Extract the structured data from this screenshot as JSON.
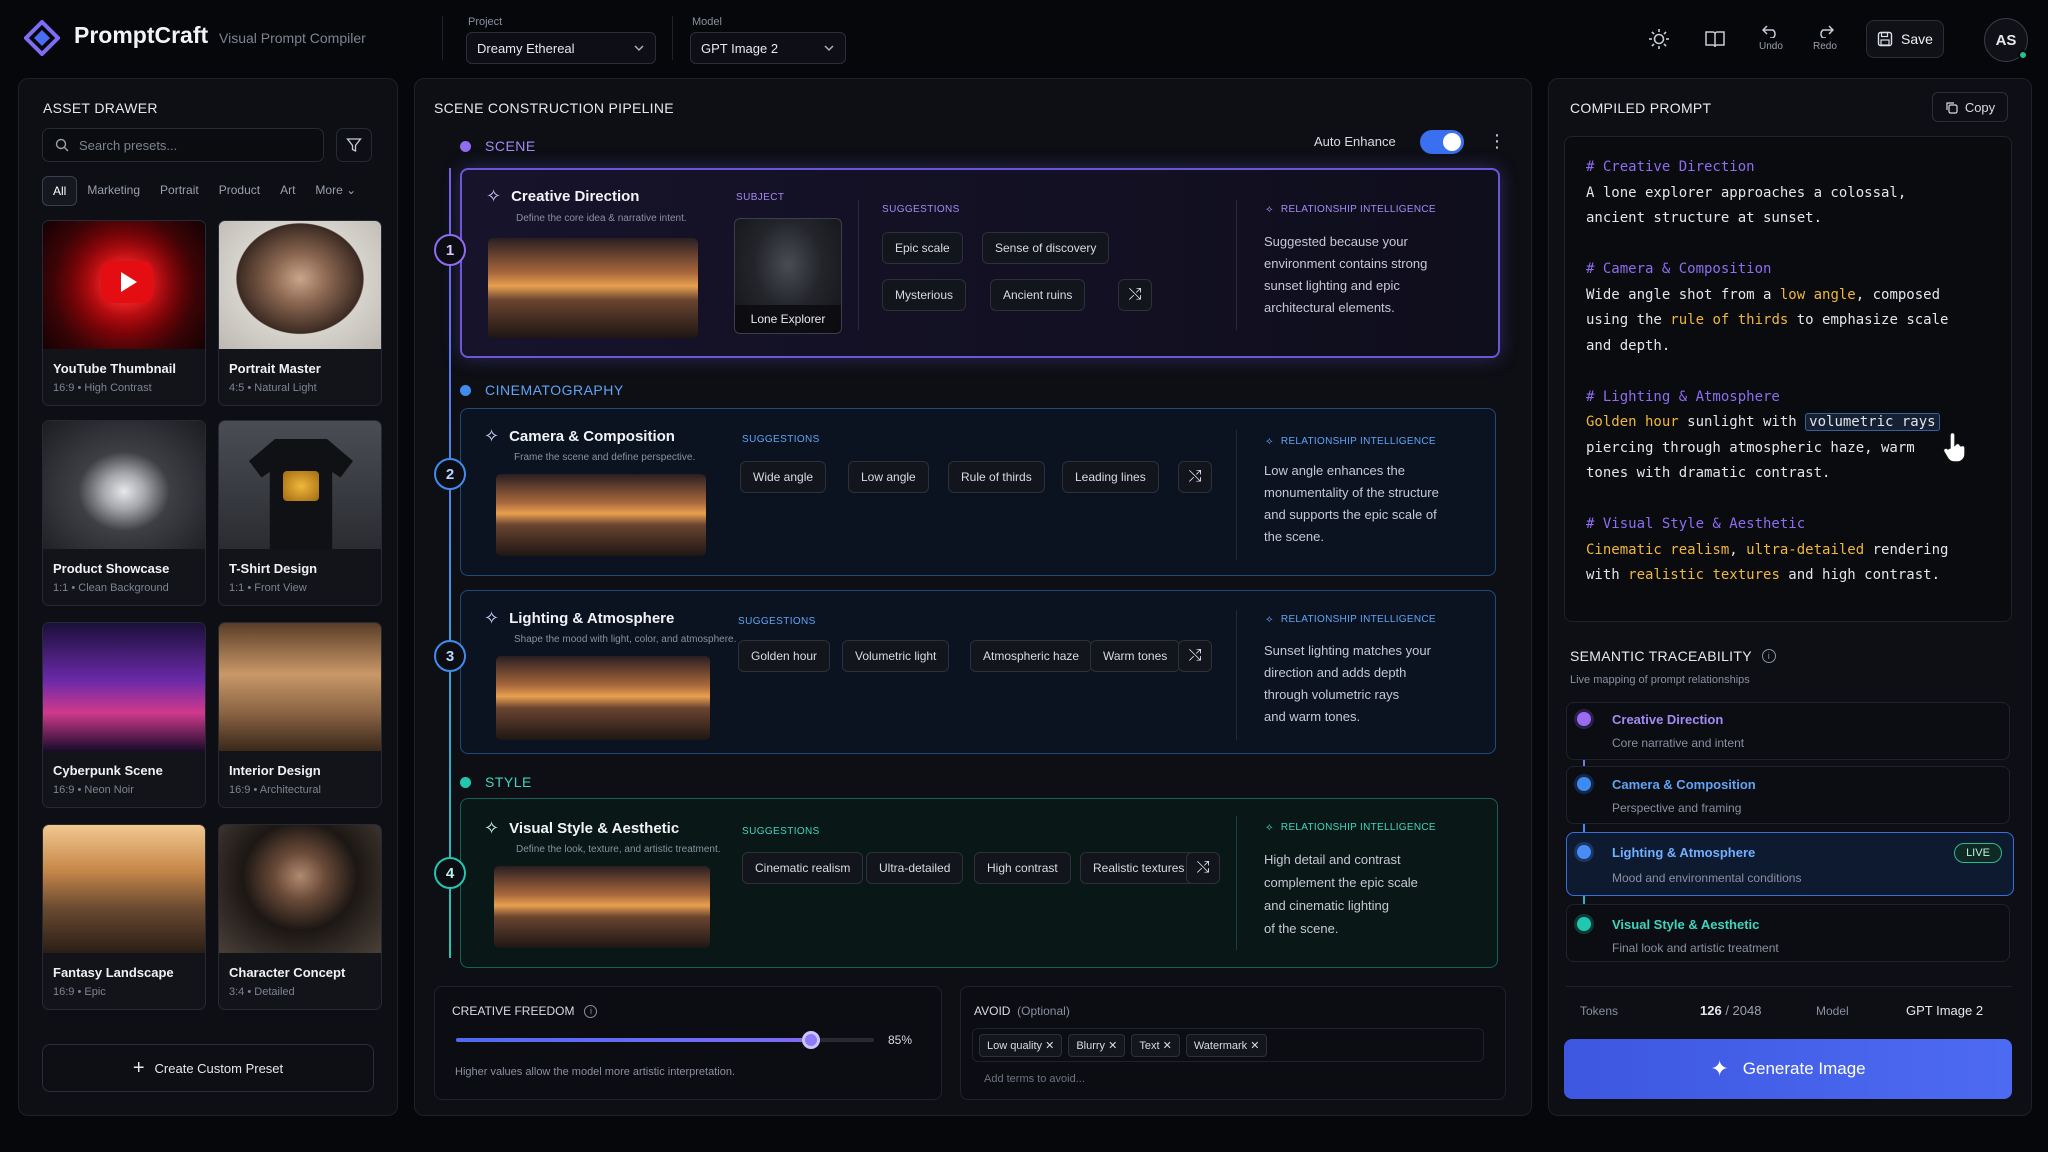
{
  "app": {
    "name": "PromptCraft",
    "subtitle": "Visual Prompt Compiler",
    "logo_icon": "diamond-logo-icon"
  },
  "topbar": {
    "project_label": "Project",
    "project_value": "Dreamy Ethereal",
    "model_label": "Model",
    "model_value": "GPT Image 2",
    "undo_label": "Undo",
    "redo_label": "Redo",
    "save_label": "Save",
    "avatar_initials": "AS"
  },
  "asset_drawer": {
    "title": "ASSET DRAWER",
    "search_placeholder": "Search presets...",
    "filters": [
      "All",
      "Marketing",
      "Portrait",
      "Product",
      "Art",
      "More"
    ],
    "active_filter": "All",
    "presets": [
      {
        "title": "YouTube Thumbnail",
        "ratio": "16:9",
        "tag": "High Contrast"
      },
      {
        "title": "Portrait Master",
        "ratio": "4:5",
        "tag": "Natural Light"
      },
      {
        "title": "Product Showcase",
        "ratio": "1:1",
        "tag": "Clean Background"
      },
      {
        "title": "T-Shirt Design",
        "ratio": "1:1",
        "tag": "Front View"
      },
      {
        "title": "Cyberpunk Scene",
        "ratio": "16:9",
        "tag": "Neon Noir"
      },
      {
        "title": "Interior Design",
        "ratio": "16:9",
        "tag": "Architectural"
      },
      {
        "title": "Fantasy Landscape",
        "ratio": "16:9",
        "tag": "Epic"
      },
      {
        "title": "Character Concept",
        "ratio": "3:4",
        "tag": "Detailed"
      }
    ],
    "create_label": "Create Custom Preset"
  },
  "pipeline": {
    "title": "SCENE CONSTRUCTION PIPELINE",
    "auto_enhance_label": "Auto Enhance",
    "auto_enhance_on": true,
    "sections": {
      "scene": "SCENE",
      "cinematography": "CINEMATOGRAPHY",
      "style": "STYLE"
    },
    "suggestions_label": "SUGGESTIONS",
    "subject_label": "SUBJECT",
    "subject_value": "Lone Explorer",
    "rel_label": "RELATIONSHIP INTELLIGENCE",
    "steps": [
      {
        "num": "1",
        "title": "Creative Direction",
        "desc": "Define the core idea & narrative intent.",
        "tags": [
          "Epic scale",
          "Sense of discovery",
          "Mysterious",
          "Ancient ruins"
        ],
        "rel": [
          "Suggested because your",
          "environment contains strong",
          "sunset lighting and epic",
          "architectural elements."
        ]
      },
      {
        "num": "2",
        "title": "Camera & Composition",
        "desc": "Frame the scene and define perspective.",
        "tags": [
          "Wide angle",
          "Low angle",
          "Rule of thirds",
          "Leading lines"
        ],
        "rel": [
          "Low angle enhances the",
          "monumentality of the structure",
          "and supports the epic scale of",
          "the scene."
        ]
      },
      {
        "num": "3",
        "title": "Lighting & Atmosphere",
        "desc": "Shape the mood with light, color, and atmosphere.",
        "tags": [
          "Golden hour",
          "Volumetric light",
          "Atmospheric haze",
          "Warm tones"
        ],
        "rel": [
          "Sunset lighting matches your",
          "direction and adds depth",
          "through volumetric rays",
          "and warm tones."
        ]
      },
      {
        "num": "4",
        "title": "Visual Style & Aesthetic",
        "desc": "Define the look, texture, and artistic treatment.",
        "tags": [
          "Cinematic realism",
          "Ultra-detailed",
          "High contrast",
          "Realistic textures"
        ],
        "rel": [
          "High detail and contrast",
          "complement the epic scale",
          "and cinematic lighting",
          "of the scene."
        ]
      }
    ],
    "creative_freedom": {
      "label": "CREATIVE FREEDOM",
      "value": 85,
      "value_label": "85%",
      "hint": "Higher values allow the model more artistic interpretation."
    },
    "avoid": {
      "label": "AVOID",
      "optional": "(Optional)",
      "terms": [
        "Low quality",
        "Blurry",
        "Text",
        "Watermark"
      ],
      "placeholder": "Add terms to avoid..."
    }
  },
  "compiled": {
    "title": "COMPILED PROMPT",
    "copy_label": "Copy",
    "c1": "# Creative Direction",
    "l1": "A lone explorer approaches a colossal,",
    "l2": "ancient structure at sunset.",
    "c2": "# Camera & Composition",
    "l3a": "Wide angle shot from a ",
    "l3k": "low angle",
    "l3b": ", composed",
    "l4a": "using the ",
    "l4k": "rule of thirds",
    "l4b": " to emphasize scale",
    "l5": "and depth.",
    "c3": "# Lighting & Atmosphere",
    "l6k": "Golden hour",
    "l6a": " sunlight with ",
    "l6h": "volumetric rays",
    "l7": "piercing through atmospheric haze, warm",
    "l8": "tones with dramatic contrast.",
    "c4": "# Visual Style & Aesthetic",
    "l9k1": "Cinematic realism",
    "l9a": ", ",
    "l9k2": "ultra-detailed",
    "l9b": " rendering",
    "l10a": "with ",
    "l10k": "realistic textures",
    "l10b": " and high contrast."
  },
  "traceability": {
    "title": "SEMANTIC TRACEABILITY",
    "subtitle": "Live mapping of prompt relationships",
    "items": [
      {
        "title": "Creative Direction",
        "sub": "Core narrative and intent",
        "color": "#9b6cf2"
      },
      {
        "title": "Camera & Composition",
        "sub": "Perspective and framing",
        "color": "#3f8cf0"
      },
      {
        "title": "Lighting & Atmosphere",
        "sub": "Mood and environmental conditions",
        "color": "#4a8cf5",
        "badge": "LIVE"
      },
      {
        "title": "Visual Style & Aesthetic",
        "sub": "Final look and artistic treatment",
        "color": "#22c7b0"
      }
    ]
  },
  "footer": {
    "tokens_label": "Tokens",
    "tokens_used": "126",
    "tokens_sep": "/ 2048",
    "model_label": "Model",
    "model_value": "GPT Image 2",
    "generate_label": "Generate Image"
  },
  "colors": {
    "accent": "#4d6bf2",
    "scene": "#8f6cf0",
    "cinematography": "#3f8cf0",
    "style": "#22c7b0",
    "keyword": "#f0b73c"
  }
}
